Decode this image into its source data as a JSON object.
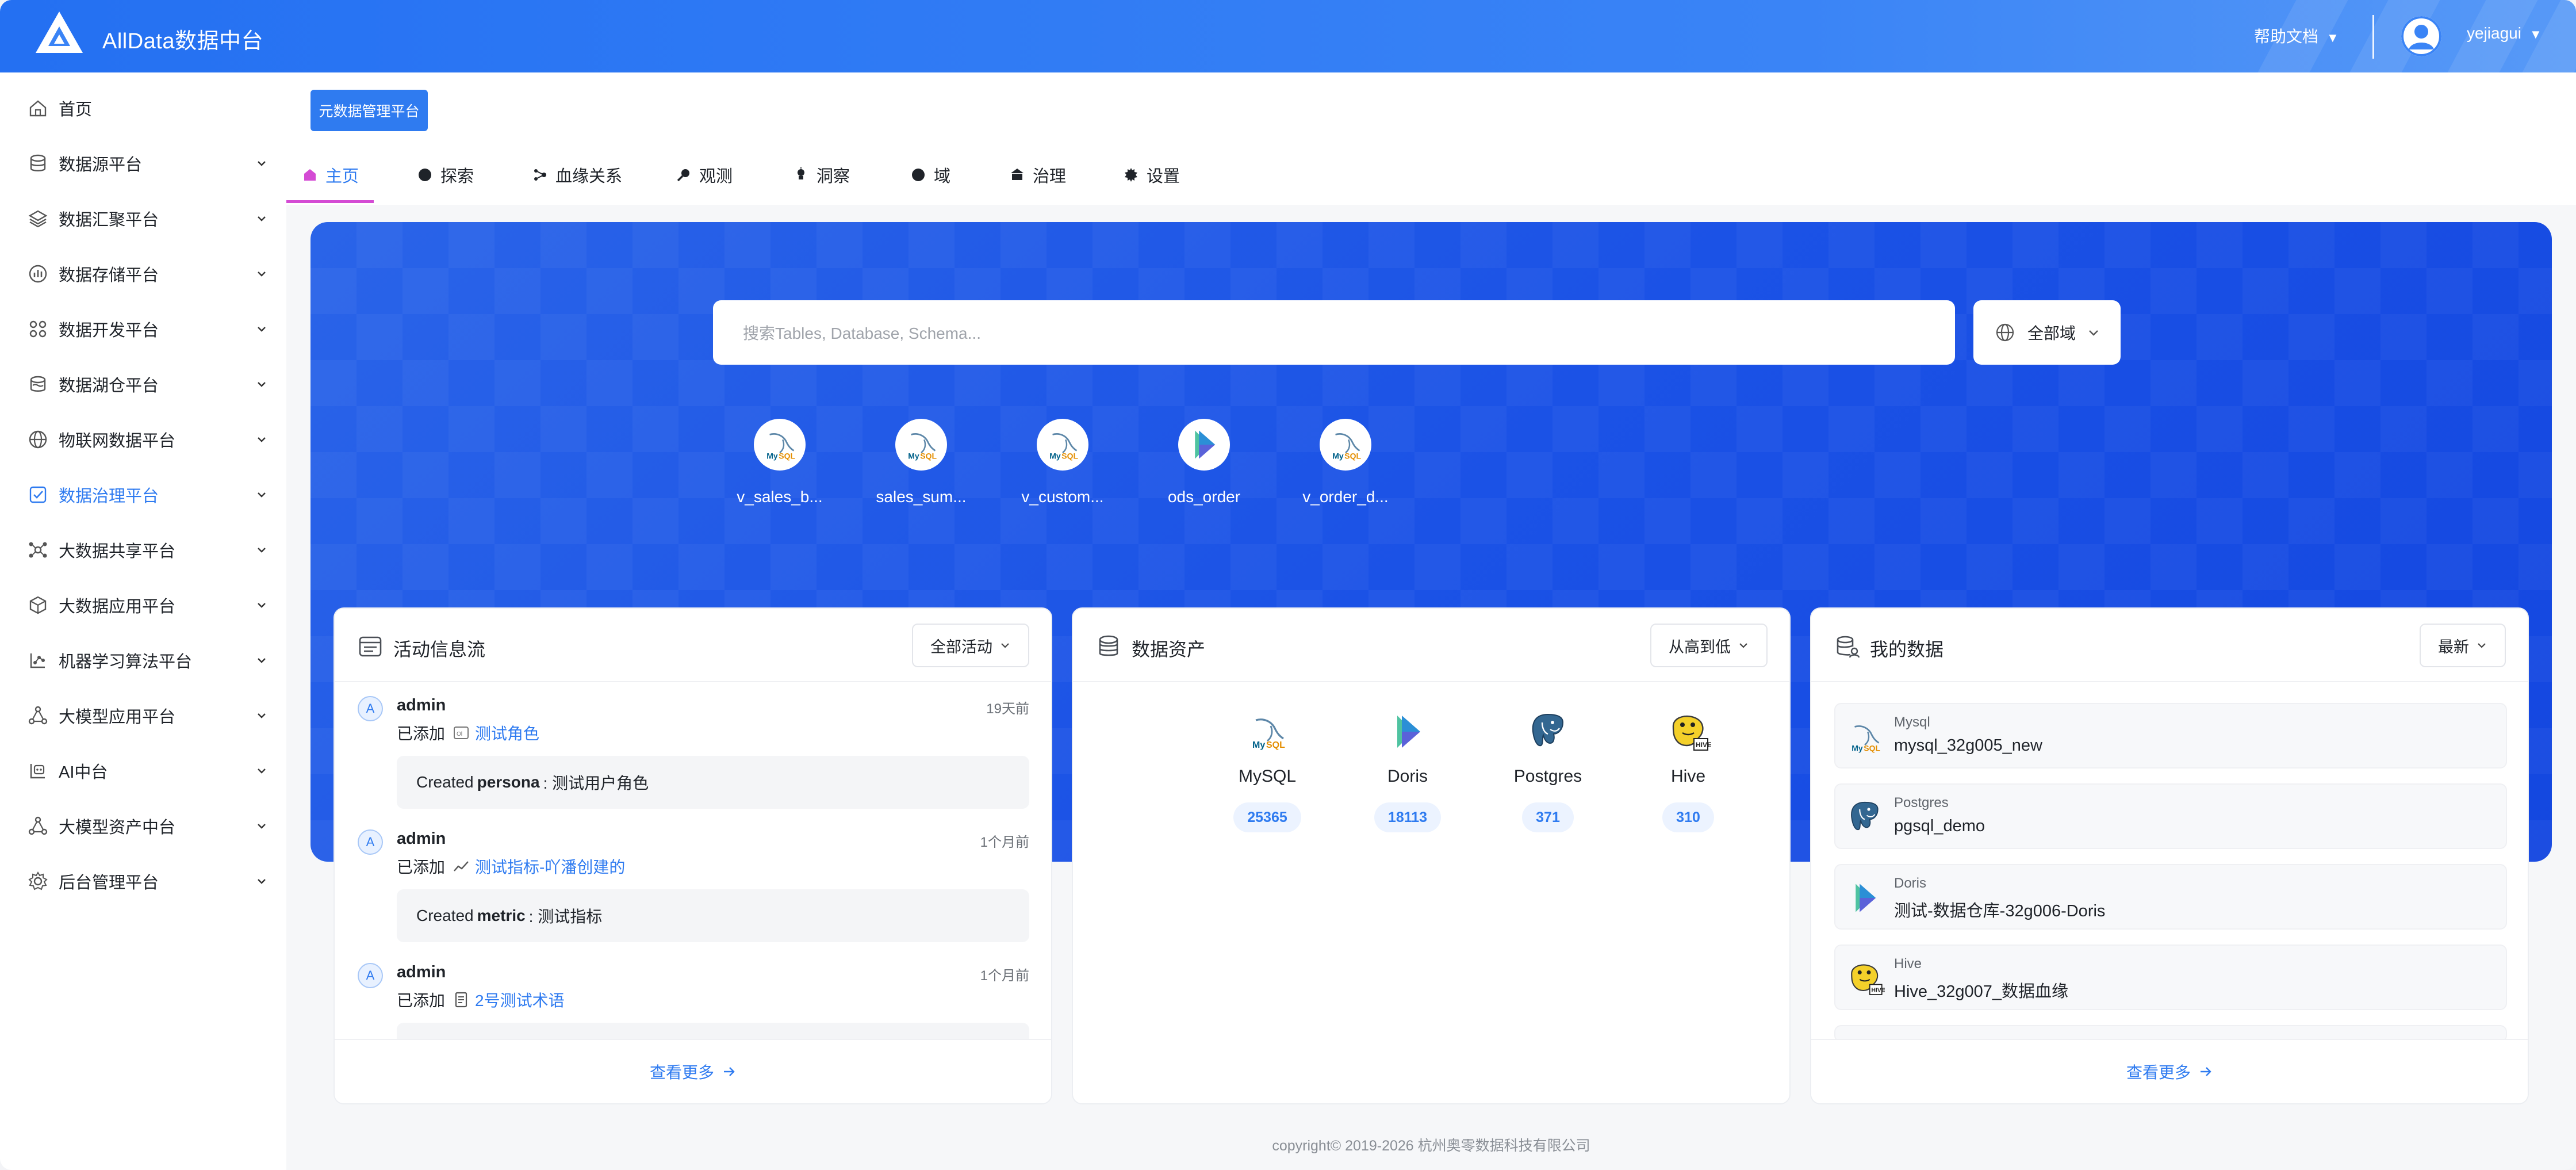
{
  "header": {
    "app_title": "AllData数据中台",
    "help_label": "帮助文档",
    "help_caret": "▼",
    "user_name": "yejiagui",
    "user_caret": "▼"
  },
  "sidebar": {
    "items": [
      {
        "label": "首页",
        "icon": "home-icon"
      },
      {
        "label": "数据源平台",
        "icon": "database-icon"
      },
      {
        "label": "数据汇聚平台",
        "icon": "layers-icon"
      },
      {
        "label": "数据存储平台",
        "icon": "bar-chart-icon"
      },
      {
        "label": "数据开发平台",
        "icon": "apps-icon"
      },
      {
        "label": "数据湖仓平台",
        "icon": "lake-icon"
      },
      {
        "label": "物联网数据平台",
        "icon": "globe-icon"
      },
      {
        "label": "数据治理平台",
        "icon": "checkbox-icon"
      },
      {
        "label": "大数据共享平台",
        "icon": "share-icon"
      },
      {
        "label": "大数据应用平台",
        "icon": "cube-icon"
      },
      {
        "label": "机器学习算法平台",
        "icon": "ml-icon"
      },
      {
        "label": "大模型应用平台",
        "icon": "network-icon"
      },
      {
        "label": "AI中台",
        "icon": "ai-icon"
      },
      {
        "label": "大模型资产中台",
        "icon": "network-icon"
      },
      {
        "label": "后台管理平台",
        "icon": "settings-icon"
      }
    ],
    "active_index": 7
  },
  "main": {
    "meta_button": "元数据管理平台",
    "tabs": [
      {
        "label": "主页"
      },
      {
        "label": "探索"
      },
      {
        "label": "血缘关系"
      },
      {
        "label": "观测"
      },
      {
        "label": "洞察"
      },
      {
        "label": "域"
      },
      {
        "label": "治理"
      },
      {
        "label": "设置"
      }
    ],
    "search_placeholder": "搜索Tables, Database, Schema...",
    "domain_select": "全部域",
    "recent": [
      {
        "label": "v_sales_b...",
        "icon": "mysql-icon"
      },
      {
        "label": "sales_sum...",
        "icon": "mysql-icon"
      },
      {
        "label": "v_custom...",
        "icon": "mysql-icon"
      },
      {
        "label": "ods_order",
        "icon": "doris-icon"
      },
      {
        "label": "v_order_d...",
        "icon": "mysql-icon"
      }
    ]
  },
  "activity": {
    "title": "活动信息流",
    "filter": "全部活动",
    "items": [
      {
        "avatar": "A",
        "user": "admin",
        "time": "19天前",
        "action": "已添加",
        "target": "测试角色",
        "box_prefix": "Created",
        "box_bold": "persona",
        "box_suffix": ": 测试用户角色"
      },
      {
        "avatar": "A",
        "user": "admin",
        "time": "1个月前",
        "action": "已添加",
        "target": "测试指标-吖潘创建的",
        "box_prefix": "Created",
        "box_bold": "metric",
        "box_suffix": ": 测试指标"
      },
      {
        "avatar": "A",
        "user": "admin",
        "time": "1个月前",
        "action": "已添加",
        "target": "2号测试术语"
      }
    ],
    "more": "查看更多"
  },
  "assets": {
    "title": "数据资产",
    "sort": "从高到低",
    "items": [
      {
        "name": "MySQL",
        "count": "25365",
        "icon": "mysql-icon"
      },
      {
        "name": "Doris",
        "count": "18113",
        "icon": "doris-icon"
      },
      {
        "name": "Postgres",
        "count": "371",
        "icon": "postgres-icon"
      },
      {
        "name": "Hive",
        "count": "310",
        "icon": "hive-icon"
      }
    ]
  },
  "mydata": {
    "title": "我的数据",
    "sort": "最新",
    "items": [
      {
        "type": "Mysql",
        "name": "mysql_32g005_new",
        "icon": "mysql-icon"
      },
      {
        "type": "Postgres",
        "name": "pgsql_demo",
        "icon": "postgres-icon"
      },
      {
        "type": "Doris",
        "name": "测试-数据仓库-32g006-Doris",
        "icon": "doris-icon"
      },
      {
        "type": "Hive",
        "name": "Hive_32g007_数据血缘",
        "icon": "hive-icon"
      }
    ],
    "more": "查看更多"
  },
  "footer": {
    "copyright": "copyright© 2019-2026 杭州奥零数据科技有限公司"
  },
  "colors": {
    "brand": "#2470f2",
    "accent": "#2f7bf0",
    "tab_underline": "#d44bd4",
    "hero": "#1b52e6"
  }
}
